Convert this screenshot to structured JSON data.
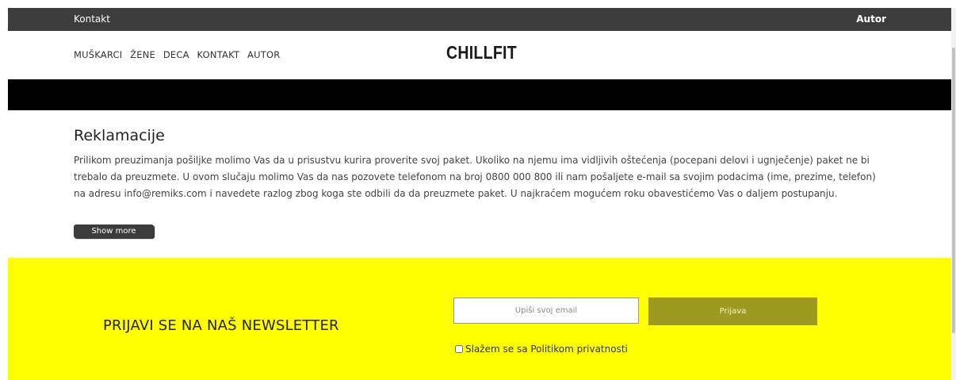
{
  "topbar": {
    "left_link": "Kontakt",
    "right_link": "Autor"
  },
  "nav": {
    "items": [
      "MUŠKARCI",
      "ŽENE",
      "DECA",
      "KONTAKT",
      "AUTOR"
    ]
  },
  "logo": "CHILLFIT",
  "content": {
    "title": "Reklamacije",
    "body": "Prilikom preuzimanja pošiljke molimo Vas da u prisustvu kurira proverite svoj paket. Ukoliko na njemu ima vidljivih oštećenja (pocepani delovi i ugnječenje) paket ne bi trebalo da preuzmete. U ovom slučaju molimo Vas da nas pozovete telefonom na broj 0800 000 800 ili nam pošaljete e-mail sa svojim podacima (ime, prezime, telefon) na adresu info@remiks.com i navedete razlog zbog koga ste odbili da da preuzmete paket. U najkraćem mogućem roku obavestićemo Vas o daljem postupanju.",
    "show_more_label": "Show more"
  },
  "newsletter": {
    "title": "PRIJAVI SE NA NAŠ NEWSLETTER",
    "email_placeholder": "Upiši svoj email",
    "email_value": "",
    "submit_label": "Prijava",
    "privacy_label": "Slažem se sa Politikom privatnosti",
    "privacy_checked": false
  },
  "colors": {
    "topbar_bg": "#3d3d3d",
    "banner_bg": "#000000",
    "newsletter_bg": "#ffff00",
    "submit_bg": "#9e9a21"
  }
}
